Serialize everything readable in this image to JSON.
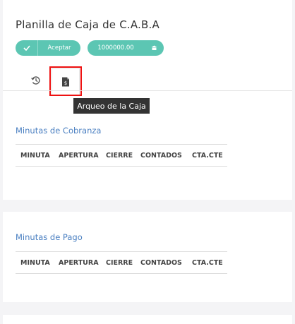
{
  "header": {
    "title": "Planilla de Caja de C.A.B.A"
  },
  "actions": {
    "aceptar_label": "Aceptar",
    "amount": "1000000.00"
  },
  "tabs": {
    "history_icon": "history-icon",
    "arqueo_icon": "cash-document-icon",
    "tooltip": "Arqueo de la Caja"
  },
  "cobranza": {
    "title": "Minutas de Cobranza",
    "columns": [
      "MINUTA",
      "APERTURA",
      "CIERRE",
      "CONTADOS",
      "CTA.CTE"
    ]
  },
  "pago": {
    "title": "Minutas de Pago",
    "columns": [
      "MINUTA",
      "APERTURA",
      "CIERRE",
      "CONTADOS",
      "CTA.CTE"
    ]
  },
  "colors": {
    "accent": "#5cc6b3",
    "link": "#4a7fc1",
    "highlight": "#e11"
  }
}
